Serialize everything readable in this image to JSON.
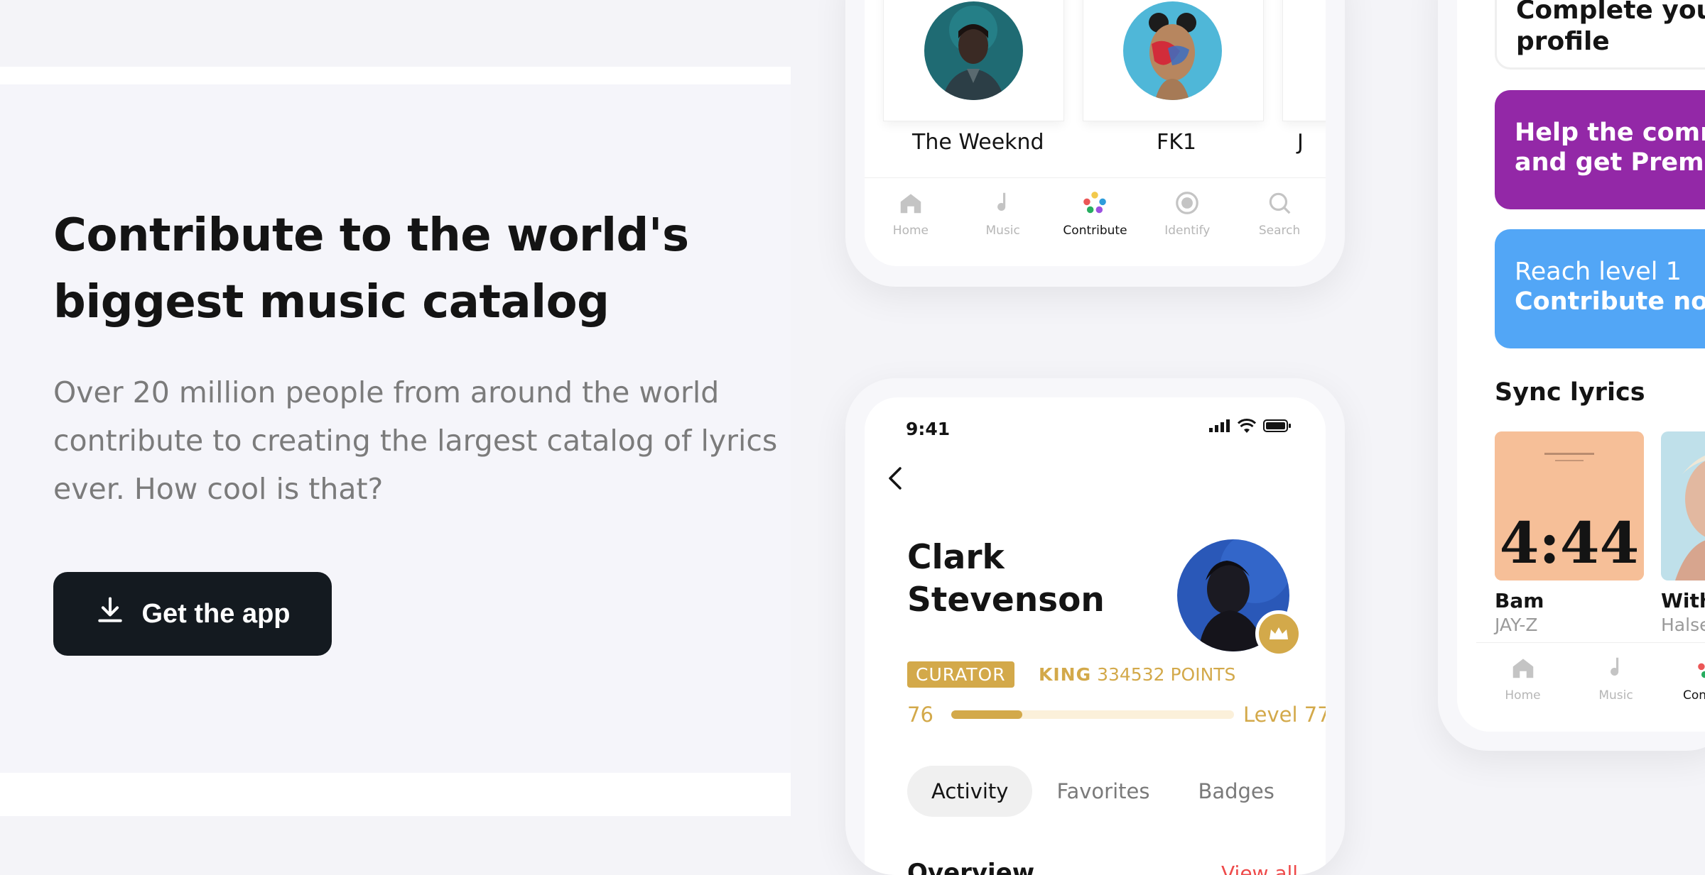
{
  "hero": {
    "title": "Contribute to the world's biggest music catalog",
    "subtitle": "Over 20 million people from around the world contribute to creating the largest catalog of lyrics ever. How cool is that?",
    "cta_label": "Get the app",
    "cta_icon": "download-icon"
  },
  "artists": [
    {
      "name": "The Weeknd"
    },
    {
      "name": "FK1"
    },
    {
      "name": "J"
    }
  ],
  "tabbar": {
    "tabs": [
      {
        "label": "Home",
        "icon": "home-icon"
      },
      {
        "label": "Music",
        "icon": "music-note-icon"
      },
      {
        "label": "Contribute",
        "icon": "contribute-dots-icon",
        "active": true
      },
      {
        "label": "Identify",
        "icon": "identify-icon"
      },
      {
        "label": "Search",
        "icon": "search-icon"
      }
    ],
    "right_tabs": [
      "Home",
      "Music",
      "Contribu"
    ]
  },
  "profile": {
    "status_time": "9:41",
    "name_line1": "Clark",
    "name_line2": "Stevenson",
    "badge": "CURATOR",
    "rank": "KING",
    "points": "334532 POINTS",
    "level_current": "76",
    "level_next": "Level 77",
    "progress": 0.25,
    "tabs": [
      "Activity",
      "Favorites",
      "Badges"
    ],
    "active_tab": "Activity",
    "overview_title": "Overview",
    "view_all": "View all"
  },
  "right_panel": {
    "complete_line1": "Complete your",
    "complete_line2": "profile",
    "promo_purple_line1": "Help the commu",
    "promo_purple_line2": "and get Premium",
    "promo_blue_line1": "Reach level 1",
    "promo_blue_line2": "Contribute now",
    "sync_title": "Sync lyrics",
    "songs": [
      {
        "title": "Bam",
        "artist": "JAY-Z",
        "art_text": "4:44"
      },
      {
        "title": "Witho",
        "artist": "Halsey"
      }
    ]
  },
  "colors": {
    "dark": "#141a20",
    "gold": "#d3a94a",
    "purple": "#9328a7",
    "blue": "#52a6f6",
    "red": "#ee4a4a"
  }
}
